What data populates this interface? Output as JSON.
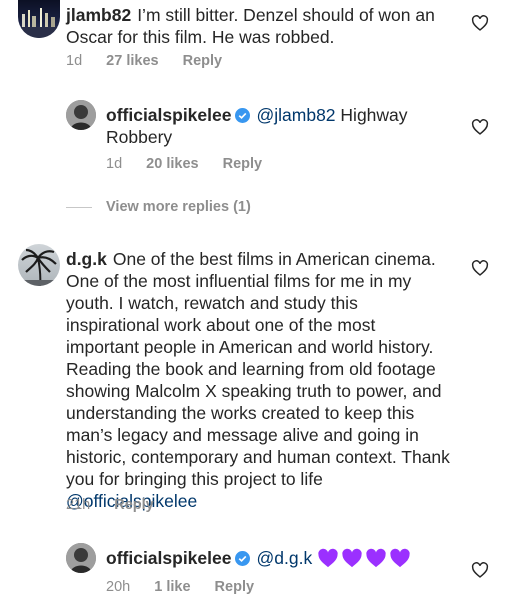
{
  "comments": [
    {
      "username": "jlamb82",
      "text": "I’m still bitter. Denzel should of won an Oscar for this film. He was robbed.",
      "time": "1d",
      "likes": "27 likes",
      "reply": "Reply"
    },
    {
      "username": "officialspikelee",
      "mention": "@jlamb82",
      "text": "Highway Robbery",
      "time": "1d",
      "likes": "20 likes",
      "reply": "Reply"
    },
    {
      "username": "d.g.k",
      "text": "One of the best films in American cinema. One of the most influential films for me in my youth. I watch, rewatch and study this inspirational work about one of the most important people in American and world history. Reading the book and learning from old footage showing Malcolm X speaking truth to power, and understanding the works created to keep this man’s legacy and message alive and going in historic, contemporary and human context. Thank you for bringing this project to life",
      "mention": "@officialspikelee",
      "time": "21h",
      "reply": "Reply"
    },
    {
      "username": "officialspikelee",
      "mention": "@d.g.k",
      "emoji": "💜💜💜💜",
      "time": "20h",
      "likes": "1 like",
      "reply": "Reply"
    }
  ],
  "view_more": "View more replies (1)",
  "colors": {
    "text": "#262626",
    "meta": "#8e8e8e",
    "mention": "#00376b",
    "verified": "#3897f0",
    "purple_heart": "#9b30ff"
  },
  "icons": [
    "heart-outline-icon",
    "verified-badge-icon",
    "purple-heart-emoji"
  ]
}
